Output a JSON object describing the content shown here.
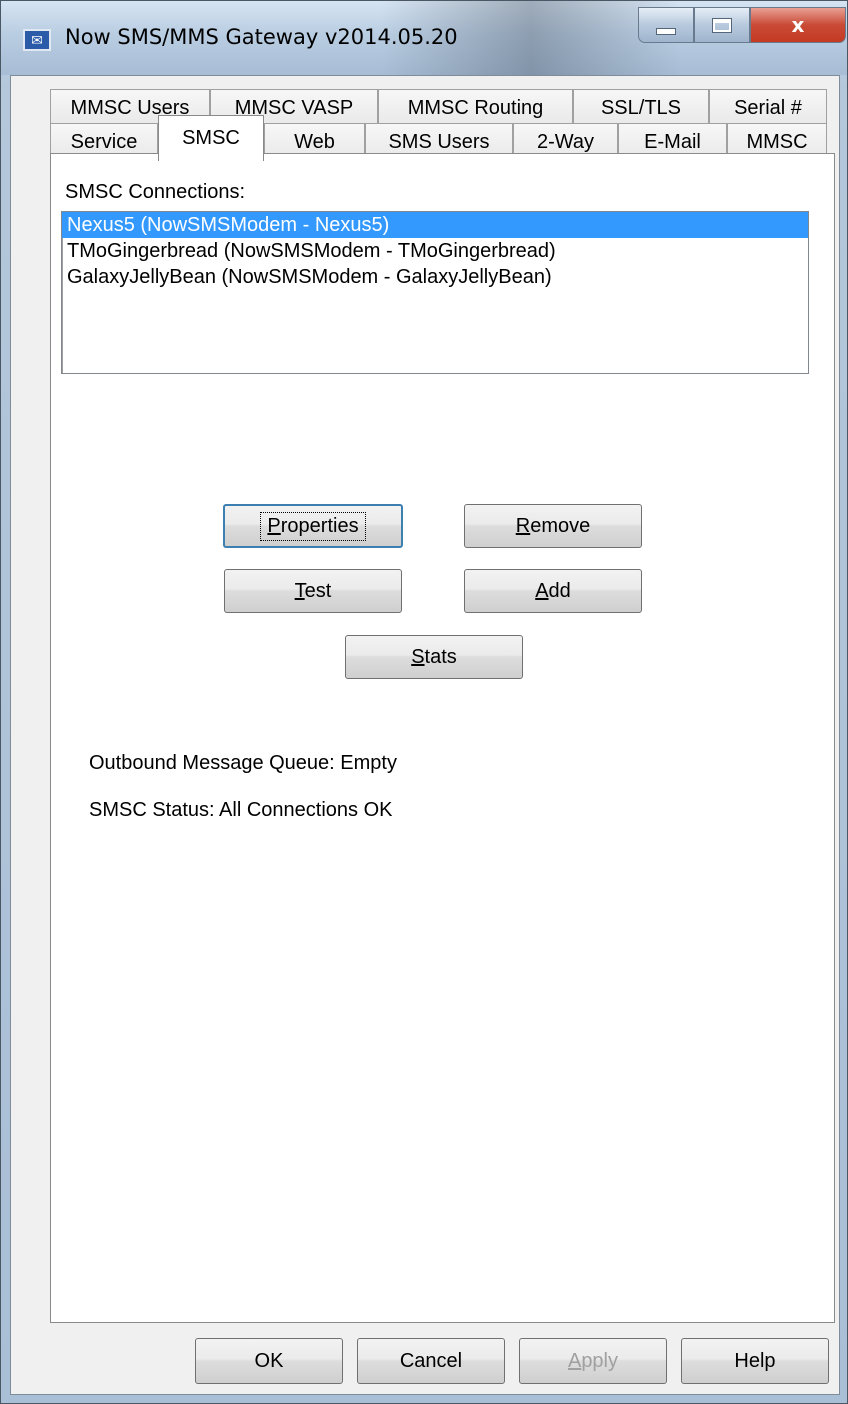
{
  "window": {
    "title": "Now SMS/MMS Gateway v2014.05.20",
    "close_glyph": "x"
  },
  "tabs": {
    "row1": [
      "MMSC Users",
      "MMSC VASP",
      "MMSC Routing",
      "SSL/TLS",
      "Serial #"
    ],
    "row2": [
      "Service",
      "SMSC",
      "Web",
      "SMS Users",
      "2-Way",
      "E-Mail",
      "MMSC"
    ],
    "active": "SMSC"
  },
  "smsc": {
    "connections_label": "SMSC Connections:",
    "connections": [
      "Nexus5 (NowSMSModem - Nexus5)",
      "TMoGingerbread (NowSMSModem - TMoGingerbread)",
      "GalaxyJellyBean (NowSMSModem - GalaxyJellyBean)"
    ],
    "selected_index": 0,
    "buttons": {
      "properties": {
        "u": "P",
        "rest": "roperties"
      },
      "remove": {
        "u": "R",
        "rest": "emove"
      },
      "test": {
        "u": "T",
        "rest": "est"
      },
      "add": {
        "u": "A",
        "rest": "dd"
      },
      "stats": {
        "u": "S",
        "rest": "tats"
      }
    },
    "queue_text": "Outbound Message Queue:  Empty",
    "status_text": "SMSC Status:  All Connections OK"
  },
  "footer": {
    "ok": "OK",
    "cancel": "Cancel",
    "apply_u": "A",
    "apply_rest": "pply",
    "help": "Help"
  },
  "colors": {
    "selection": "#3399ff",
    "close_button": "#c94a36"
  }
}
